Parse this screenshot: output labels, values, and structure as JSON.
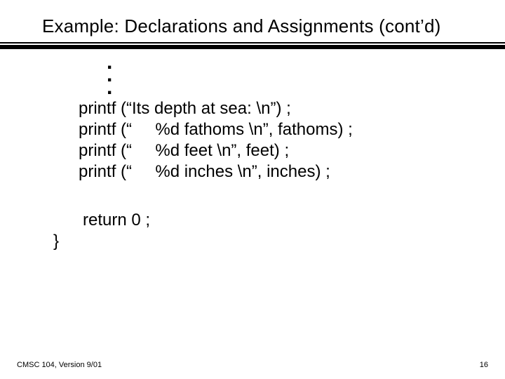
{
  "title": "Example: Declarations and Assignments (cont’d)",
  "code": {
    "line1": "printf (“Its depth at sea: \\n”) ;",
    "line2": "printf (“     %d fathoms \\n”, fathoms) ;",
    "line3": "printf (“     %d feet \\n”, feet) ;",
    "line4": "printf (“     %d inches \\n”, inches) ;",
    "ret": "return 0 ;",
    "brace": "}"
  },
  "dots": {
    "d1": ".",
    "d2": ".",
    "d3": "."
  },
  "footer": {
    "left": "CMSC 104, Version 9/01",
    "right": "16"
  }
}
